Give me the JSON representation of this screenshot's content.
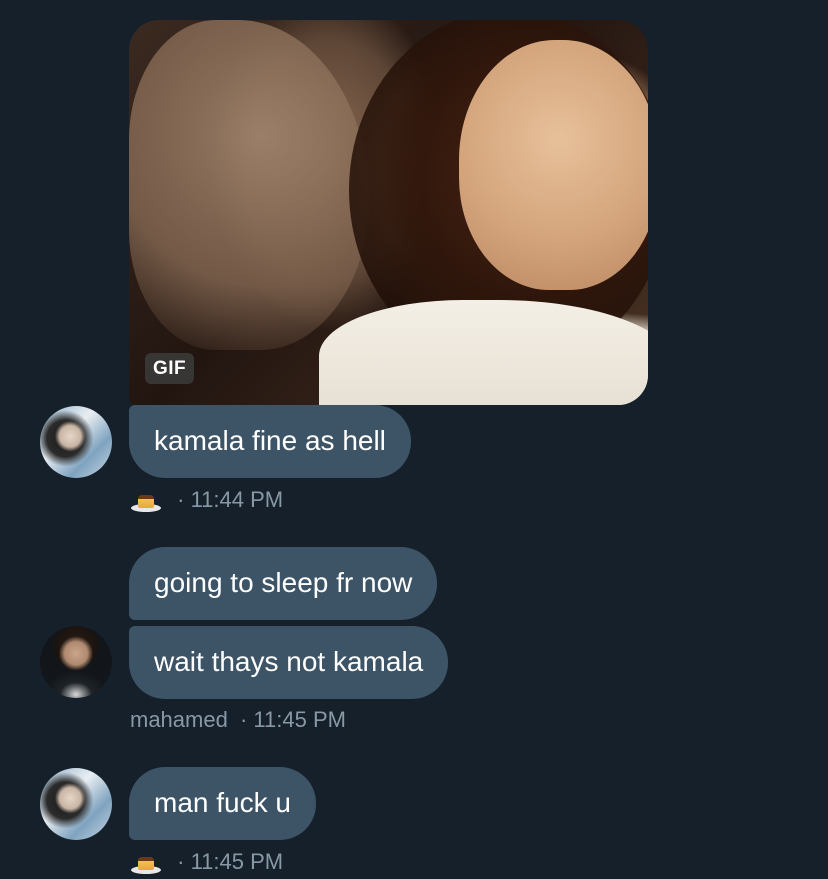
{
  "messages": [
    {
      "media_badge": "GIF",
      "text": "kamala fine as hell",
      "meta": {
        "dot": "·",
        "time": "11:44 PM"
      },
      "meta_icon": "flan-pudding-emoji"
    },
    {
      "texts": [
        "going to sleep fr now",
        "wait thays not kamala"
      ],
      "meta": {
        "sender": "mahamed",
        "dot": "·",
        "time": "11:45 PM"
      }
    },
    {
      "text": "man fuck u",
      "meta": {
        "dot": "·",
        "time": "11:45 PM"
      },
      "meta_icon": "flan-pudding-emoji"
    }
  ],
  "colors": {
    "background": "#15202b",
    "bubble": "#3d5466",
    "meta_text": "#8899a6"
  }
}
